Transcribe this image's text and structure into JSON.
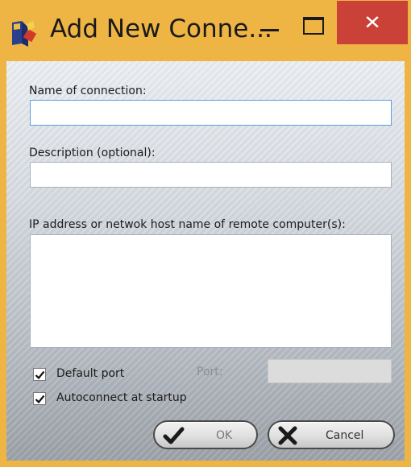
{
  "window": {
    "title": "Add New Conne...",
    "close_glyph": "✕",
    "frame_color": "#efb544",
    "close_color": "#c94137"
  },
  "form": {
    "name_label": "Name of connection:",
    "name_value": "",
    "description_label": "Description (optional):",
    "description_value": "",
    "hosts_label": "IP address or netwok host name of remote computer(s):",
    "hosts_value": "",
    "default_port_label": "Default port",
    "default_port_checked": true,
    "port_label": "Port:",
    "port_value": "",
    "autoconnect_label": "Autoconnect at startup",
    "autoconnect_checked": true
  },
  "buttons": {
    "ok_label": "OK",
    "ok_icon": "checkmark-icon",
    "cancel_label": "Cancel",
    "cancel_icon": "x-icon"
  }
}
